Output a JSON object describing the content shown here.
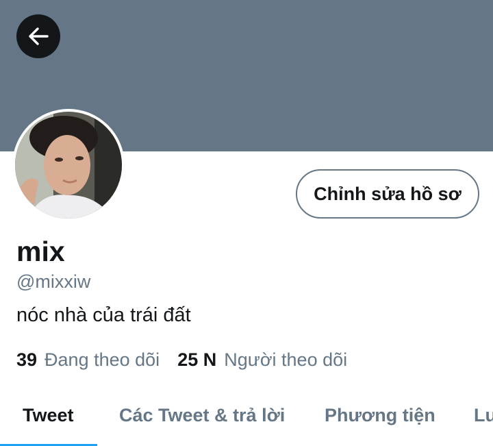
{
  "header": {
    "back_icon": "arrow-left-icon",
    "banner_color": "#657786"
  },
  "profile": {
    "avatar_icon": "profile-photo",
    "edit_button_label": "Chỉnh sửa hồ sơ",
    "name": "mix",
    "handle": "@mixxiw",
    "bio": "nóc nhà của trái đất"
  },
  "stats": {
    "following_count": "39",
    "following_label": "Đang theo dõi",
    "followers_count": "25 N",
    "followers_label": "Người theo dõi"
  },
  "tabs": [
    {
      "label": "Tweet",
      "active": true
    },
    {
      "label": "Các Tweet & trả lời",
      "active": false
    },
    {
      "label": "Phương tiện",
      "active": false
    },
    {
      "label": "Lượt thích",
      "active": false
    }
  ],
  "colors": {
    "accent": "#1da1f2",
    "text_primary": "#14171a",
    "text_secondary": "#657786"
  }
}
